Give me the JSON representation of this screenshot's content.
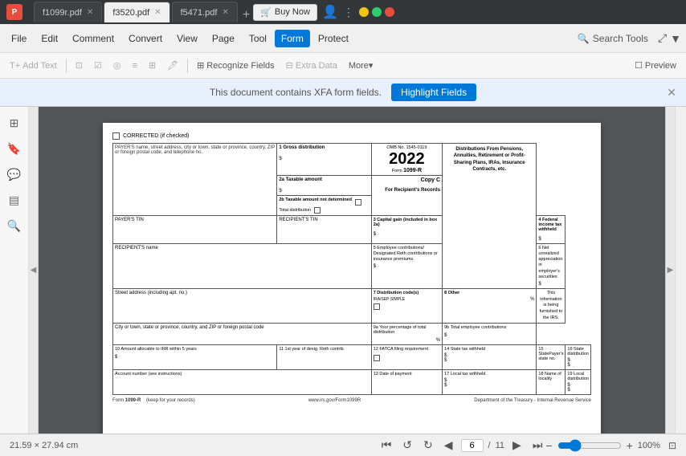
{
  "titleBar": {
    "appIcon": "P",
    "tabs": [
      {
        "id": "tab1",
        "label": "f1099r.pdf",
        "active": false,
        "closable": true
      },
      {
        "id": "tab2",
        "label": "f3520.pdf",
        "active": true,
        "closable": true
      },
      {
        "id": "tab3",
        "label": "f5471.pdf",
        "active": false,
        "closable": true
      }
    ],
    "addTabIcon": "+",
    "buyNow": "Buy Now",
    "winControls": [
      "–",
      "□",
      "✕"
    ]
  },
  "menuBar": {
    "items": [
      {
        "id": "file",
        "label": "File"
      },
      {
        "id": "edit",
        "label": "Edit"
      },
      {
        "id": "comment",
        "label": "Comment"
      },
      {
        "id": "convert",
        "label": "Convert"
      },
      {
        "id": "view",
        "label": "View"
      },
      {
        "id": "page",
        "label": "Page"
      },
      {
        "id": "tool",
        "label": "Tool"
      },
      {
        "id": "form",
        "label": "Form",
        "active": true
      },
      {
        "id": "protect",
        "label": "Protect"
      }
    ],
    "searchTools": "Search Tools"
  },
  "toolbar": {
    "items": [
      {
        "id": "add-text",
        "label": "Add Text",
        "icon": "T",
        "disabled": true
      },
      {
        "id": "link",
        "label": "",
        "icon": "⛓",
        "disabled": true
      },
      {
        "id": "checkbox",
        "label": "",
        "icon": "☑",
        "disabled": true
      },
      {
        "id": "radio",
        "label": "",
        "icon": "◎",
        "disabled": true
      },
      {
        "id": "list",
        "label": "",
        "icon": "≡",
        "disabled": true
      },
      {
        "id": "dropdown",
        "label": "",
        "icon": "⊡",
        "disabled": true
      },
      {
        "id": "sign",
        "label": "",
        "icon": "✍",
        "disabled": true
      },
      {
        "id": "recognize",
        "label": "Recognize Fields",
        "icon": "⊞",
        "disabled": false
      },
      {
        "id": "extra-data",
        "label": "Extra Data",
        "icon": "⊟",
        "disabled": true
      },
      {
        "id": "more",
        "label": "More▾",
        "disabled": false
      },
      {
        "id": "preview",
        "label": "Preview",
        "icon": "☐",
        "disabled": false
      }
    ]
  },
  "notification": {
    "message": "This document contains XFA form fields.",
    "buttonLabel": "Highlight Fields",
    "closeIcon": "✕"
  },
  "leftPanel": {
    "icons": [
      {
        "id": "pages",
        "symbol": "⊞",
        "label": "Pages"
      },
      {
        "id": "bookmarks",
        "symbol": "🔖",
        "label": "Bookmarks"
      },
      {
        "id": "comments",
        "symbol": "💬",
        "label": "Comments"
      },
      {
        "id": "layers",
        "symbol": "▤",
        "label": "Layers"
      },
      {
        "id": "search",
        "symbol": "🔍",
        "label": "Search"
      }
    ]
  },
  "pdfForm": {
    "correctedLabel": "CORRECTED (if checked)",
    "checkboxCorrected": "",
    "payerLabel": "PAYER'S name, street address, city or town, state or province, country, ZIP or foreign postal code, and telephone no.",
    "grossDistLabel": "1  Gross distribution",
    "ombLabel": "OMB No. 1545-0119",
    "year": "2022",
    "formId": "1099-R",
    "formTitle": "Distributions From Pensions, Annuities, Retirement or Profit-Sharing Plans, IRAs, Insurance Contracts, etc.",
    "taxableAmtLabel": "2a  Taxable amount",
    "taxableAmtNotDetLabel": "2b  Taxable amount not determined",
    "totalDistLabel": "Total distribution",
    "copyLabel": "Copy C",
    "copyForLabel": "For Recipient's Records",
    "payerTINLabel": "PAYER'S TIN",
    "recipientTINLabel": "RECIPIENT'S TIN",
    "capGainLabel": "3  Capital gain (included in box 2a)",
    "fedIncomeTaxLabel": "4  Federal income tax withheld",
    "empContribLabel": "5  Employee contributions/ Designated Roth contributions or insurance premiums",
    "netUnrealLabel": "6  Net unrealized appreciation in employer's securities",
    "recipientNameLabel": "RECIPIENT'S name",
    "streetAddrLabel": "Street address (including apt. no.)",
    "distCodeLabel": "7  Distribution code(s)",
    "otherLabel": "8  Other",
    "distCodeValue": "IRA/SEP SIMPLE",
    "cityLabel": "City or town, state or province, country, and ZIP or foreign postal code",
    "pctTotalDistLabel": "9a  Your percentage of total distribution",
    "totalEmpContribLabel": "9b  Total employee contributions",
    "pctSymbol": "%",
    "amtIRRLabel": "10  Amount allocable to IRR within 5 years",
    "firstYrDesigLabel": "11  1st year of desig. Roth contrib.",
    "fatcaLabel": "12  FATCA filing requirement",
    "stateTaxLabel": "14  State tax withheld",
    "stateNoLabel": "15  StatePayer's state no.",
    "stateDistLabel": "16  State distribution",
    "acctNumLabel": "Account number (see instructions)",
    "datePaymentLabel": "13  Date of payment",
    "localTaxLabel": "17  Local tax withheld",
    "localityLabel": "18  Name of locality",
    "localDistLabel": "19  Local distribution",
    "formBottomId": "1099-R",
    "keepLabel": "(keep for your records)",
    "irsUrl": "www.irs.gov/Form1099R",
    "treasuryLabel": "Department of the Treasury - Internal Revenue Service",
    "infoLabel": "This information is being furnished to the IRS."
  },
  "statusBar": {
    "dimensions": "21.59 × 27.94 cm",
    "currentPage": "6",
    "totalPages": "11",
    "zoomPercent": "100%",
    "zoomValue": 100
  }
}
